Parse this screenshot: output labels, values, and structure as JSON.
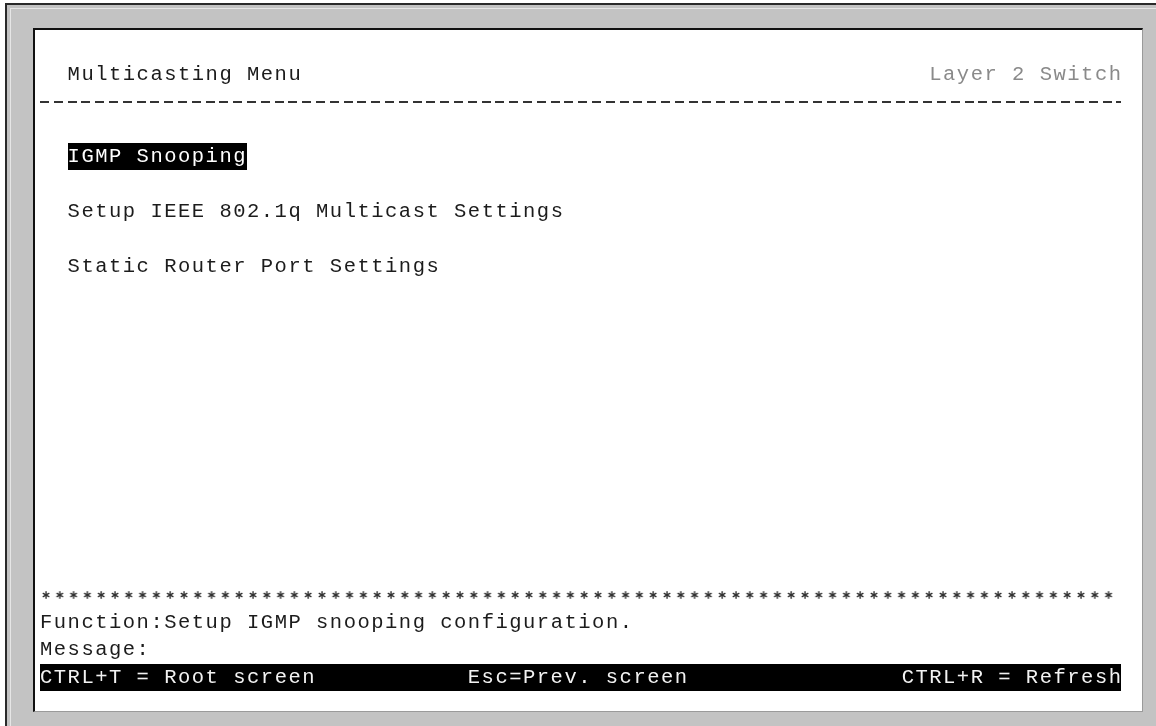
{
  "header": {
    "title": "Multicasting Menu",
    "device": "Layer 2 Switch"
  },
  "menu": {
    "items": [
      {
        "label": "IGMP Snooping",
        "selected": true
      },
      {
        "label": "Setup IEEE 802.1q Multicast Settings",
        "selected": false
      },
      {
        "label": "Static Router Port Settings",
        "selected": false
      }
    ]
  },
  "status": {
    "function": "Function:Setup IGMP snooping configuration.",
    "message": "Message:"
  },
  "hint_bar": {
    "hints": [
      "CTRL+T = Root screen",
      "Esc=Prev. screen",
      "CTRL+R = Refresh"
    ]
  }
}
